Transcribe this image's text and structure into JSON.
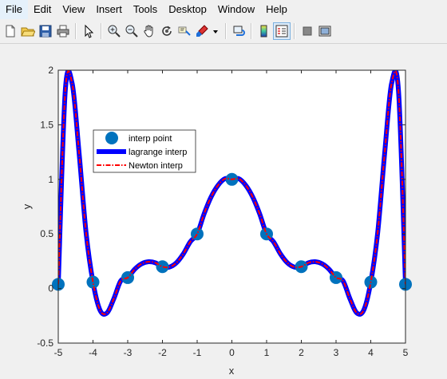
{
  "menu": [
    "File",
    "Edit",
    "View",
    "Insert",
    "Tools",
    "Desktop",
    "Window",
    "Help"
  ],
  "toolbar_icons": [
    "new-file-icon",
    "open-folder-icon",
    "save-icon",
    "print-icon",
    "pointer-arrow-icon",
    "zoom-in-icon",
    "zoom-out-icon",
    "pan-hand-icon",
    "rotate-3d-icon",
    "data-cursor-icon",
    "brush-icon",
    "brush-dropdown-icon",
    "link-plot-icon",
    "colorbar-icon",
    "legend-icon",
    "hide-plot-tools-icon",
    "show-plot-tools-icon"
  ],
  "colors": {
    "point": "#0072bd",
    "lagrange": "#0000ff",
    "newton": "#ff0000",
    "axes_bg": "#ffffff"
  },
  "chart_data": {
    "type": "line",
    "title": "",
    "xlabel": "x",
    "ylabel": "y",
    "xlim": [
      -5,
      5
    ],
    "ylim": [
      -0.5,
      2
    ],
    "xticks": [
      "-5",
      "-4",
      "-3",
      "-2",
      "-1",
      "0",
      "1",
      "2",
      "3",
      "4",
      "5"
    ],
    "yticks": [
      "-0.5",
      "0",
      "0.5",
      "1",
      "1.5",
      "2"
    ],
    "legend_position": "upper-left",
    "series": [
      {
        "name": "interp point",
        "style": "markers",
        "x": [
          -5,
          -4,
          -3,
          -2,
          -1,
          0,
          1,
          2,
          3,
          4,
          5
        ],
        "y": [
          0.0385,
          0.0588,
          0.1,
          0.2,
          0.5,
          1,
          0.5,
          0.2,
          0.1,
          0.0588,
          0.0385
        ]
      },
      {
        "name": "lagrange interp",
        "style": "thick-solid",
        "x": [
          -5,
          -4.8,
          -4.6,
          -4.4,
          -4.2,
          -4,
          -3.8,
          -3.6,
          -3.4,
          -3.2,
          -3,
          -2.8,
          -2.6,
          -2.4,
          -2.2,
          -2,
          -1.8,
          -1.6,
          -1.4,
          -1.2,
          -1,
          -0.8,
          -0.6,
          -0.4,
          -0.2,
          0,
          0.2,
          0.4,
          0.6,
          0.8,
          1,
          1.2,
          1.4,
          1.6,
          1.8,
          2,
          2.2,
          2.4,
          2.6,
          2.8,
          3,
          3.2,
          3.4,
          3.6,
          3.8,
          4,
          4.2,
          4.4,
          4.6,
          4.8,
          5
        ],
        "y": [
          0.0385,
          1.8044,
          1.8787,
          1.2399,
          0.5141,
          0.0588,
          -0.1969,
          -0.2247,
          -0.0935,
          0.0706,
          0.1,
          0.1763,
          0.2262,
          0.2453,
          0.2353,
          0.2,
          0.1965,
          0.2349,
          0.3163,
          0.4275,
          0.5,
          0.6842,
          0.8382,
          0.9455,
          1.0058,
          1,
          1.0058,
          0.9455,
          0.8382,
          0.6842,
          0.5,
          0.4275,
          0.3163,
          0.2349,
          0.1965,
          0.2,
          0.2353,
          0.2453,
          0.2262,
          0.1763,
          0.1,
          0.0706,
          -0.0935,
          -0.2247,
          -0.1969,
          0.0588,
          0.5141,
          1.2399,
          1.8787,
          1.8044,
          0.0385
        ]
      },
      {
        "name": "Newton interp",
        "style": "dash-dot",
        "x": [
          -5,
          -4.8,
          -4.6,
          -4.4,
          -4.2,
          -4,
          -3.8,
          -3.6,
          -3.4,
          -3.2,
          -3,
          -2.8,
          -2.6,
          -2.4,
          -2.2,
          -2,
          -1.8,
          -1.6,
          -1.4,
          -1.2,
          -1,
          -0.8,
          -0.6,
          -0.4,
          -0.2,
          0,
          0.2,
          0.4,
          0.6,
          0.8,
          1,
          1.2,
          1.4,
          1.6,
          1.8,
          2,
          2.2,
          2.4,
          2.6,
          2.8,
          3,
          3.2,
          3.4,
          3.6,
          3.8,
          4,
          4.2,
          4.4,
          4.6,
          4.8,
          5
        ],
        "y": [
          0.0385,
          1.8044,
          1.8787,
          1.2399,
          0.5141,
          0.0588,
          -0.1969,
          -0.2247,
          -0.0935,
          0.0706,
          0.1,
          0.1763,
          0.2262,
          0.2453,
          0.2353,
          0.2,
          0.1965,
          0.2349,
          0.3163,
          0.4275,
          0.5,
          0.6842,
          0.8382,
          0.9455,
          1.0058,
          1,
          1.0058,
          0.9455,
          0.8382,
          0.6842,
          0.5,
          0.4275,
          0.3163,
          0.2349,
          0.1965,
          0.2,
          0.2353,
          0.2453,
          0.2262,
          0.1763,
          0.1,
          0.0706,
          -0.0935,
          -0.2247,
          -0.1969,
          0.0588,
          0.5141,
          1.2399,
          1.8787,
          1.8044,
          0.0385
        ]
      }
    ]
  }
}
